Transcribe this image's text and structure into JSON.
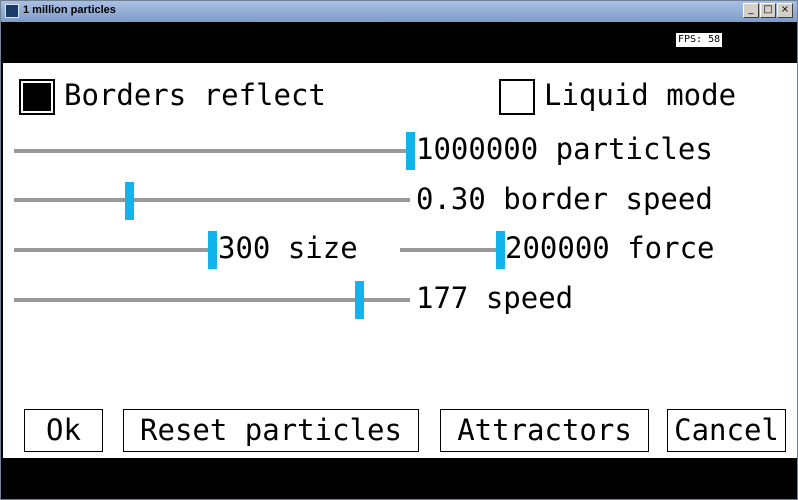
{
  "window": {
    "title": "1 million particles",
    "controls": {
      "minimize": "_",
      "maximize": "□",
      "close": "×"
    }
  },
  "fps": "FPS: 58",
  "options": {
    "borders_reflect": {
      "label": "Borders reflect",
      "checked": true
    },
    "liquid_mode": {
      "label": "Liquid mode",
      "checked": false
    }
  },
  "sliders": {
    "particles": {
      "label": "1000000 particles",
      "fraction": 1.0
    },
    "border_speed": {
      "label": "0.30 border speed",
      "fraction": 0.29
    },
    "size": {
      "label": "300 size",
      "fraction": 1.0
    },
    "force": {
      "label": "200000 force",
      "fraction": 1.0
    },
    "speed": {
      "label": "177 speed",
      "fraction": 0.87
    }
  },
  "buttons": {
    "ok": "Ok",
    "reset": "Reset particles",
    "attractors": "Attractors",
    "cancel": "Cancel"
  },
  "colors": {
    "thumb": "#12b4ee",
    "track": "#999999",
    "titlebar": "#a9c0e4"
  }
}
